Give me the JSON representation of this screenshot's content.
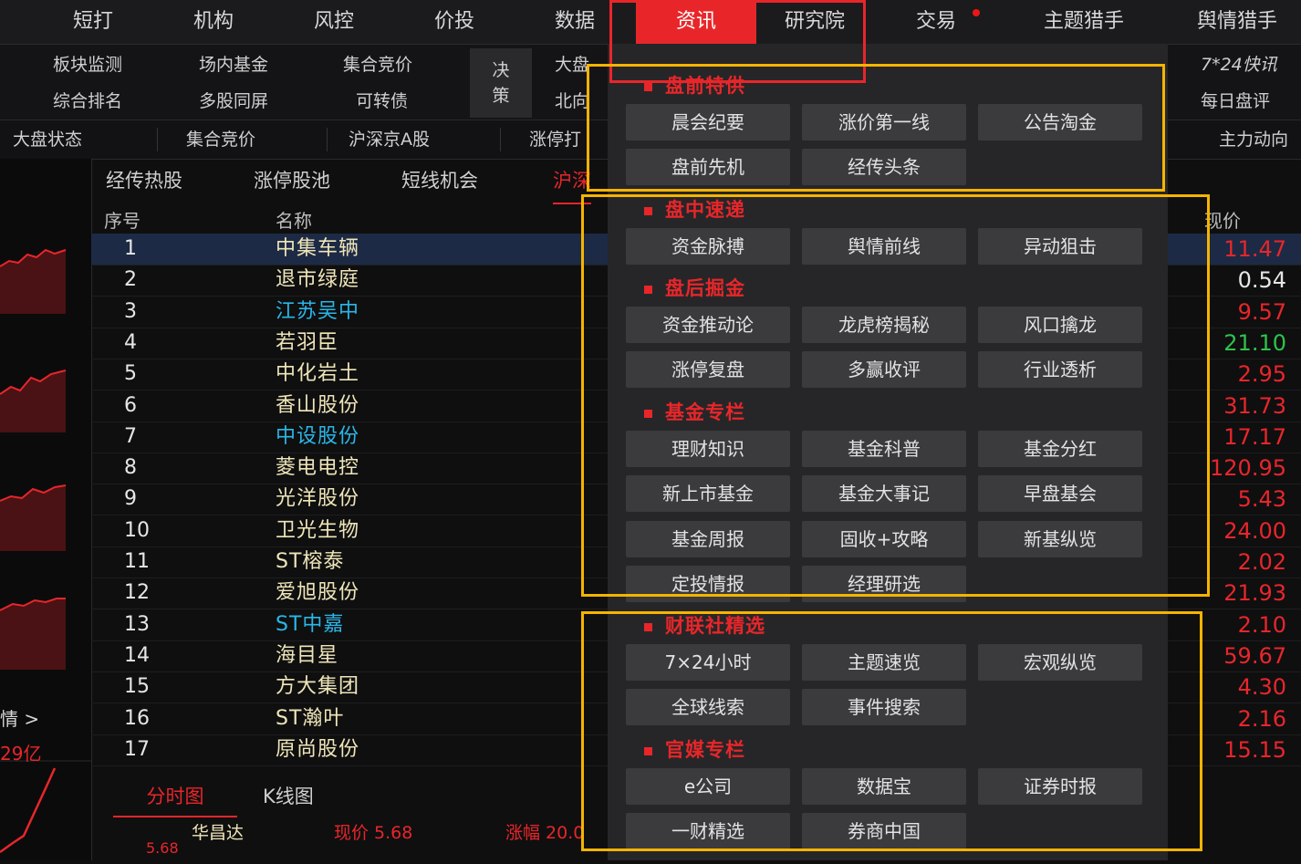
{
  "top_nav": {
    "items": [
      "短打",
      "机构",
      "风控",
      "价投",
      "数据",
      "资讯",
      "研究院",
      "交易",
      "主题猎手",
      "舆情猎手"
    ],
    "active": "资讯"
  },
  "sub_nav": {
    "row1": [
      "板块监测",
      "场内基金",
      "集合竞价"
    ],
    "row2": [
      "综合排名",
      "多股同屏",
      "可转债"
    ],
    "juece": "决策",
    "right_row1": "大盘",
    "right_row2": "北向",
    "far_right_row1": "7*24快讯",
    "far_right_row2": "每日盘评"
  },
  "tab_row3": {
    "items": [
      "大盘状态",
      "集合竞价",
      "沪深京A股",
      "涨停打"
    ],
    "right_item": "主力动向"
  },
  "list_tabs": {
    "items": [
      "经传热股",
      "涨停股池",
      "短线机会",
      "沪深"
    ],
    "active": "沪深"
  },
  "table": {
    "headers": {
      "index": "序号",
      "name": "名称",
      "price": "现价"
    },
    "rows": [
      {
        "idx": "1",
        "name": "中集车辆",
        "price": "11.47",
        "name_color": "#efe6b8",
        "price_color": "#e8262a"
      },
      {
        "idx": "2",
        "name": "退市绿庭",
        "price": "0.54",
        "name_color": "#efe6b8",
        "price_color": "#e6e6e6"
      },
      {
        "idx": "3",
        "name": "江苏吴中",
        "price": "9.57",
        "name_color": "#2ab7e8",
        "price_color": "#e8262a"
      },
      {
        "idx": "4",
        "name": "若羽臣",
        "price": "21.10",
        "name_color": "#efe6b8",
        "price_color": "#2fc34a"
      },
      {
        "idx": "5",
        "name": "中化岩土",
        "price": "2.95",
        "name_color": "#efe6b8",
        "price_color": "#e8262a"
      },
      {
        "idx": "6",
        "name": "香山股份",
        "price": "31.73",
        "name_color": "#efe6b8",
        "price_color": "#e8262a"
      },
      {
        "idx": "7",
        "name": "中设股份",
        "price": "17.17",
        "name_color": "#2ab7e8",
        "price_color": "#e8262a"
      },
      {
        "idx": "8",
        "name": "菱电电控",
        "price": "120.95",
        "name_color": "#efe6b8",
        "price_color": "#e8262a"
      },
      {
        "idx": "9",
        "name": "光洋股份",
        "price": "5.43",
        "name_color": "#efe6b8",
        "price_color": "#e8262a"
      },
      {
        "idx": "10",
        "name": "卫光生物",
        "price": "24.00",
        "name_color": "#efe6b8",
        "price_color": "#e8262a"
      },
      {
        "idx": "11",
        "name": "ST榕泰",
        "price": "2.02",
        "name_color": "#efe6b8",
        "price_color": "#e8262a"
      },
      {
        "idx": "12",
        "name": "爱旭股份",
        "price": "21.93",
        "name_color": "#efe6b8",
        "price_color": "#e8262a"
      },
      {
        "idx": "13",
        "name": "ST中嘉",
        "price": "2.10",
        "name_color": "#2ab7e8",
        "price_color": "#e8262a"
      },
      {
        "idx": "14",
        "name": "海目星",
        "price": "59.67",
        "name_color": "#efe6b8",
        "price_color": "#e8262a"
      },
      {
        "idx": "15",
        "name": "方大集团",
        "price": "4.30",
        "name_color": "#efe6b8",
        "price_color": "#e8262a"
      },
      {
        "idx": "16",
        "name": "ST瀚叶",
        "price": "2.16",
        "name_color": "#efe6b8",
        "price_color": "#e8262a"
      },
      {
        "idx": "17",
        "name": "原尚股份",
        "price": "15.15",
        "name_color": "#efe6b8",
        "price_color": "#e8262a"
      }
    ]
  },
  "left_panel": {
    "label": "情 >",
    "amount": "29亿"
  },
  "bottom_tabs": {
    "items": [
      "分时图",
      "K线图"
    ],
    "active": "分时图"
  },
  "quote_line": {
    "stock": "华昌达",
    "price_label": "现价 5.68",
    "change_label": "涨幅 20.0",
    "axis_value": "5.68"
  },
  "dropdown": {
    "sections": [
      {
        "title": "盘前特供",
        "buttons": [
          "晨会纪要",
          "涨价第一线",
          "公告淘金",
          "盘前先机",
          "经传头条"
        ]
      },
      {
        "title": "盘中速递",
        "buttons": [
          "资金脉搏",
          "舆情前线",
          "异动狙击"
        ]
      },
      {
        "title": "盘后掘金",
        "buttons": [
          "资金推动论",
          "龙虎榜揭秘",
          "风口擒龙",
          "涨停复盘",
          "多赢收评",
          "行业透析"
        ]
      },
      {
        "title": "基金专栏",
        "buttons": [
          "理财知识",
          "基金科普",
          "基金分红",
          "新上市基金",
          "基金大事记",
          "早盘基会",
          "基金周报",
          "固收+攻略",
          "新基纵览",
          "定投情报",
          "经理研选"
        ]
      },
      {
        "title": "财联社精选",
        "buttons": [
          "7×24小时",
          "主题速览",
          "宏观纵览",
          "全球线索",
          "事件搜索"
        ]
      },
      {
        "title": "官媒专栏",
        "buttons": [
          "e公司",
          "数据宝",
          "证券时报",
          "一财精选",
          "券商中国"
        ]
      }
    ]
  },
  "colors": {
    "accent": "#e8262a",
    "highlight_box_red": "#e8262a",
    "highlight_box_yellow": "#f5b400"
  }
}
